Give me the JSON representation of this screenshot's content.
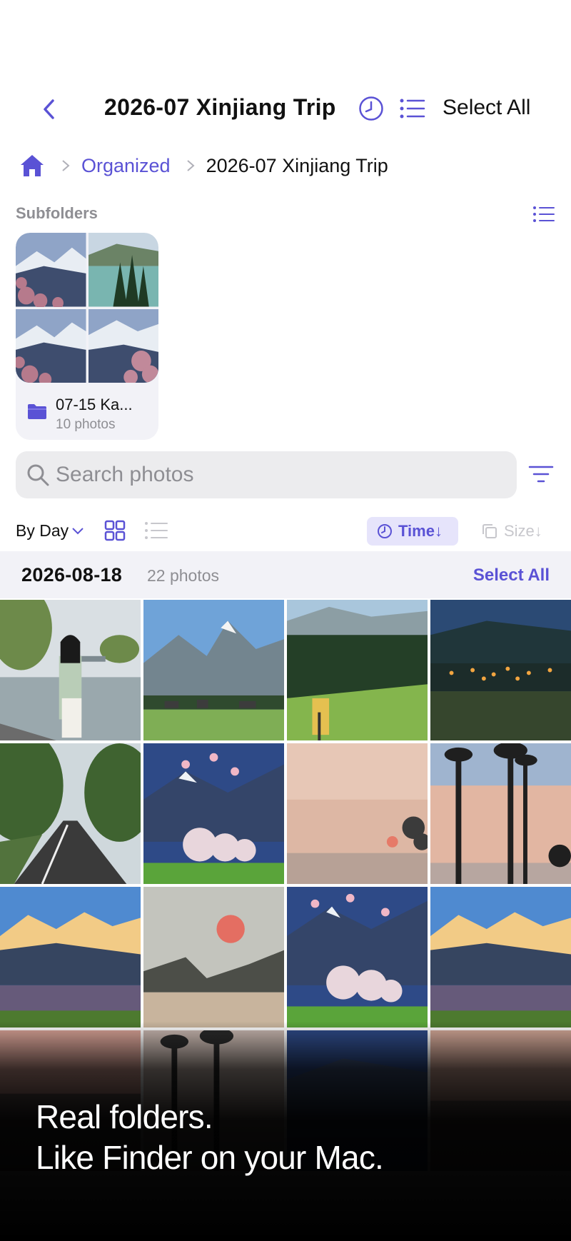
{
  "nav": {
    "title": "2026-07 Xinjiang Trip",
    "select_all": "Select All",
    "back_icon": "chevron-left-icon",
    "clock_icon": "clock-icon",
    "list_icon": "list-icon"
  },
  "breadcrumb": {
    "home_icon": "home-icon",
    "items": [
      "Organized",
      "2026-07 Xinjiang Trip"
    ]
  },
  "subfolders": {
    "label": "Subfolders",
    "folders": [
      {
        "name": "07-15 Ka...",
        "count": "10 photos"
      }
    ]
  },
  "search": {
    "placeholder": "Search photos",
    "value": ""
  },
  "toolbar": {
    "group_by": "By Day",
    "sort_time": "Time↓",
    "sort_size": "Size↓"
  },
  "section": {
    "date": "2026-08-18",
    "count": "22 photos",
    "select_all": "Select All"
  },
  "colors": {
    "accent": "#5a52d5",
    "accent_bg": "#e6e4fb",
    "secondary_text": "#8e8e93",
    "header_bg": "#f2f2f7"
  },
  "promo": {
    "line1": "Real folders.",
    "line2": "Like Finder on your Mac."
  }
}
